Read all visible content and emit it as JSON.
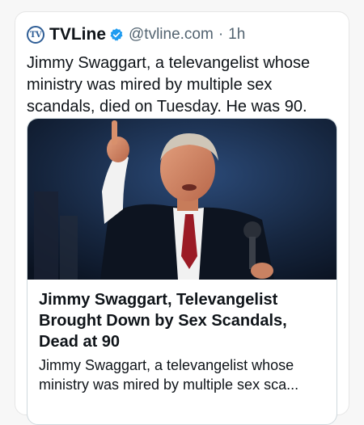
{
  "tweet": {
    "author_name": "TVLine",
    "avatar_text": "TV",
    "handle": "@tvline.com",
    "separator": "·",
    "time": "1h",
    "text": "Jimmy Swaggart, a televangelist whose ministry was mired by multiple sex scandals, died on Tuesday. He was 90."
  },
  "link_card": {
    "title": "Jimmy Swaggart, Televangelist Brought Down by Sex Scandals, Dead at 90",
    "description": "Jimmy Swaggart, a televangelist whose ministry was mired by multiple sex sca..."
  },
  "icons": {
    "verified": "verified-badge-icon"
  },
  "colors": {
    "verified_blue": "#1d9bf0",
    "secondary_text": "#536471",
    "avatar_ring": "#2f5e96"
  }
}
